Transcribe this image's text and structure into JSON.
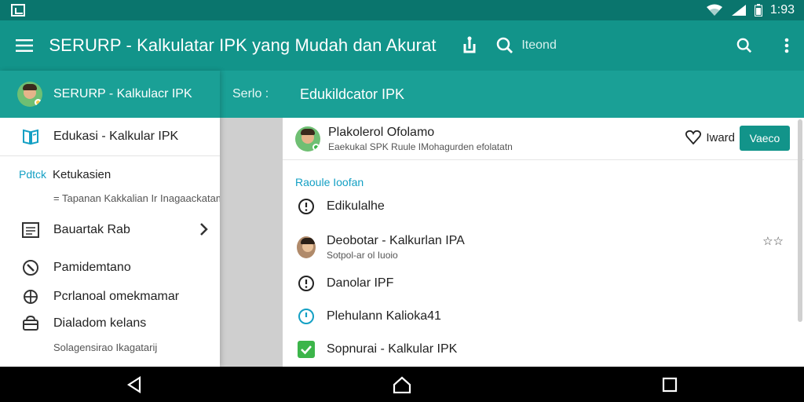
{
  "status_bar": {
    "time": "1:93"
  },
  "app_bar": {
    "title": "SERURP - Kalkulatar IPK yang Mudah dan Akurat",
    "search_placeholder": "Iteond"
  },
  "drawer": {
    "header_title": "SERURP - Kalkulacr IPK",
    "items": [
      {
        "label": "Edukasi - Kalkular IPK",
        "icon": "book-icon"
      },
      {
        "section_label": "Pdtck",
        "label": "Ketukasien",
        "sub": "= Tapanan Kakkalian Ir Inagaackatam emo"
      },
      {
        "label": "Bauartak Rab",
        "icon": "list-icon"
      },
      {
        "label": "Pamidemtano",
        "icon": "compass-icon"
      },
      {
        "label": "Pcrlanoal omekmamar",
        "icon": "globe-icon"
      },
      {
        "label": "Dialadom kelans",
        "icon": "archive-icon"
      }
    ],
    "footer_text": "Solagensirao Ikagatarij"
  },
  "middle": {
    "header_title": "Serlo :"
  },
  "detail": {
    "header_title": "Edukildcator IPK",
    "profile": {
      "name": "Plakolerol Ofolamo",
      "sub": "Eaekukal SPK Ruule IMohagurden efolatatn",
      "follow_label": "Iward",
      "button_label": "Vaeco"
    },
    "section_label": "Raoule Ioofan",
    "items": [
      {
        "label": "Edikulalhe",
        "icon": "info-icon"
      },
      {
        "label": "Deobotar - Kalkurlan IPA",
        "sub": "Sotpol-ar ol Iuoio",
        "icon": "avatar",
        "tail": "☆☆"
      },
      {
        "label": "Danolar IPF",
        "icon": "info-icon"
      },
      {
        "label": "Plehulann Kalioka41",
        "icon": "clock-icon"
      },
      {
        "label": "Sopnurai - Kalkular IPK",
        "icon": "check-icon"
      }
    ]
  },
  "colors": {
    "statusbar": "#0a756d",
    "appbar": "#12948a",
    "header": "#1aa096",
    "accent_blue": "#14a0c4",
    "check_green": "#3cb54a"
  }
}
